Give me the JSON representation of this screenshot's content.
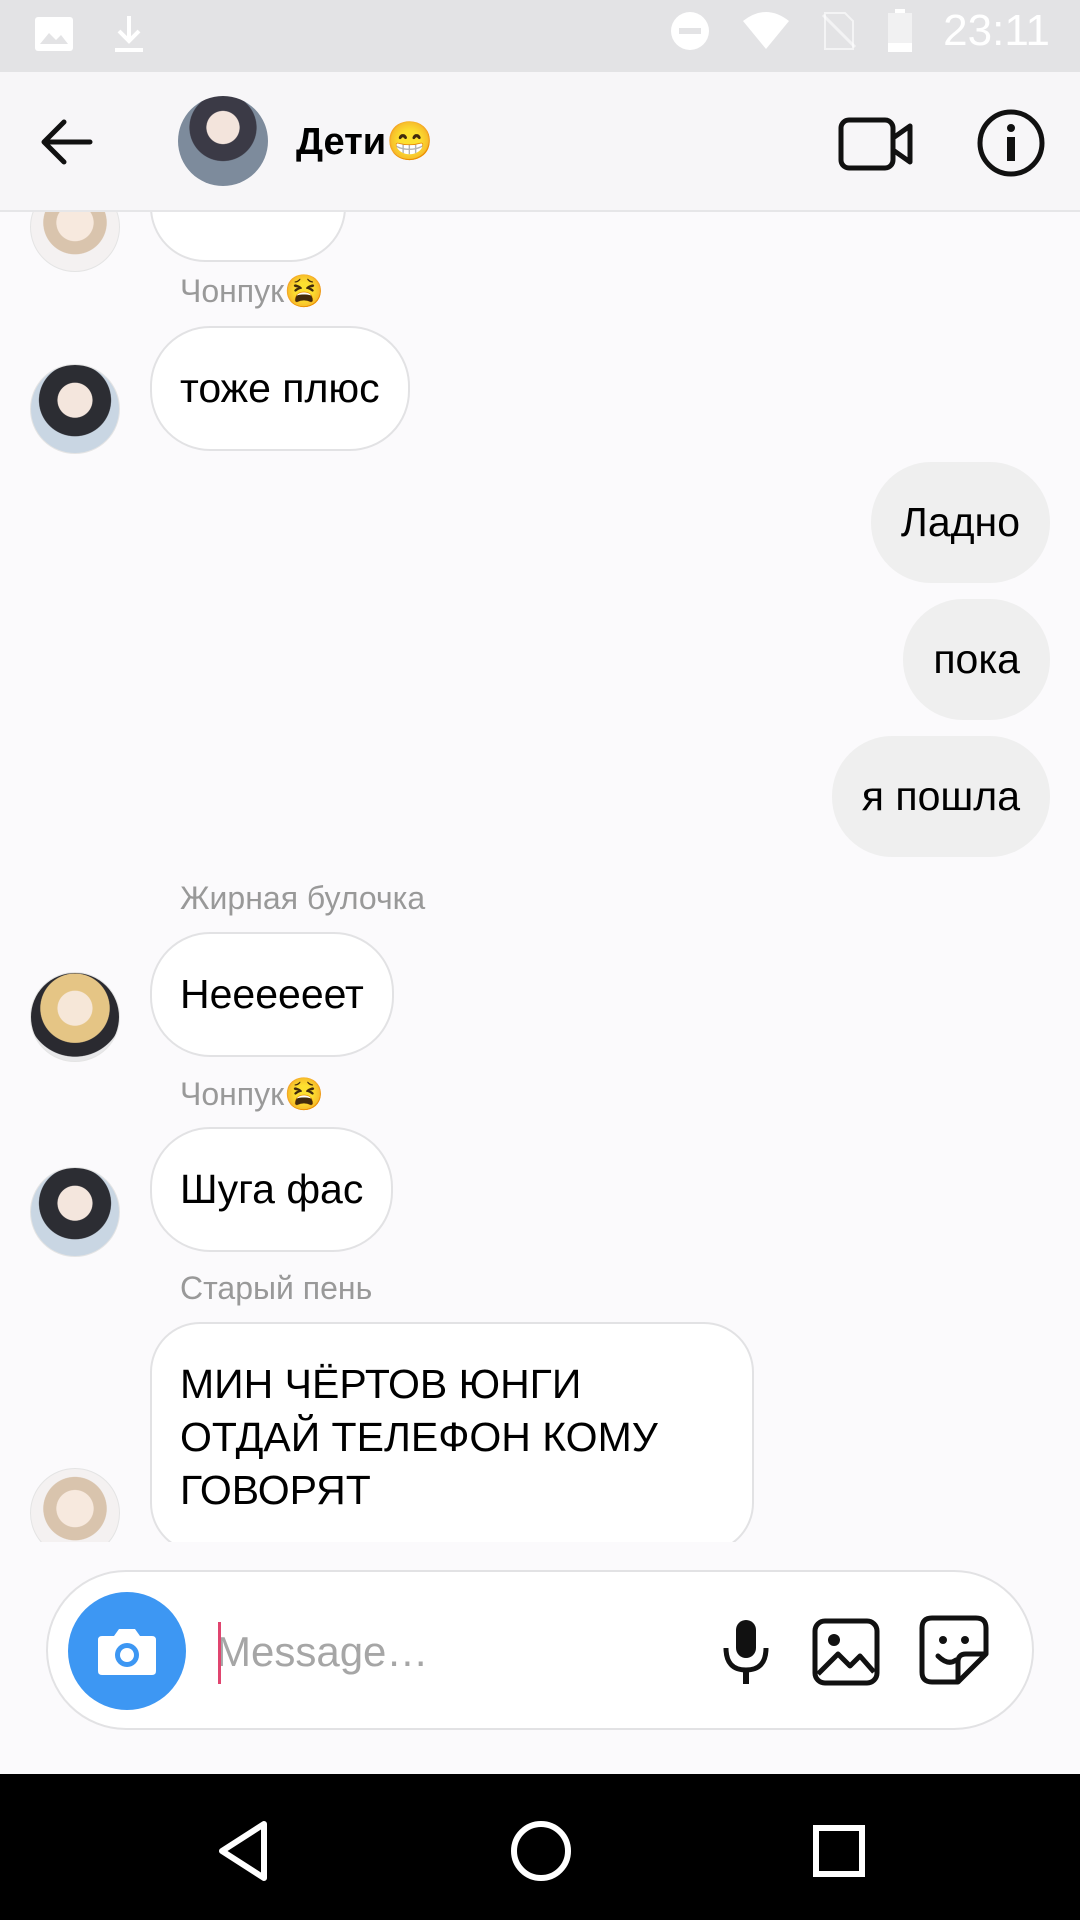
{
  "status_bar": {
    "time": "23:11"
  },
  "header": {
    "title": "Дети",
    "title_emoji": "😁"
  },
  "messages": [
    {
      "sender": "Чонпук",
      "sender_emoji": "😫",
      "text": "тоже плюс"
    },
    {
      "text": "Ладно"
    },
    {
      "text": "пока"
    },
    {
      "text": "я пошла"
    },
    {
      "sender": "Жирная булочка",
      "text": "Неееееет"
    },
    {
      "sender": "Чонпук",
      "sender_emoji": "😫",
      "text": "Шуга фас"
    },
    {
      "sender": "Старый пень",
      "text": "МИН ЧЁРТОВ ЮНГИ\nОТДАЙ ТЕЛЕФОН КОМУ\nГОВОРЯТ"
    }
  ],
  "composer": {
    "placeholder": "Message…"
  },
  "colors": {
    "accent": "#3d97f3",
    "status_bar_bg": "#e3e3e5",
    "chat_bg": "#fbfafc",
    "outgoing_bubble": "#efefef",
    "caret": "#e0456f"
  },
  "icons": {
    "back": "arrow-left-icon",
    "video": "video-camera-icon",
    "info": "info-icon",
    "camera": "camera-icon",
    "mic": "microphone-icon",
    "gallery": "image-icon",
    "sticker": "sticker-icon"
  }
}
